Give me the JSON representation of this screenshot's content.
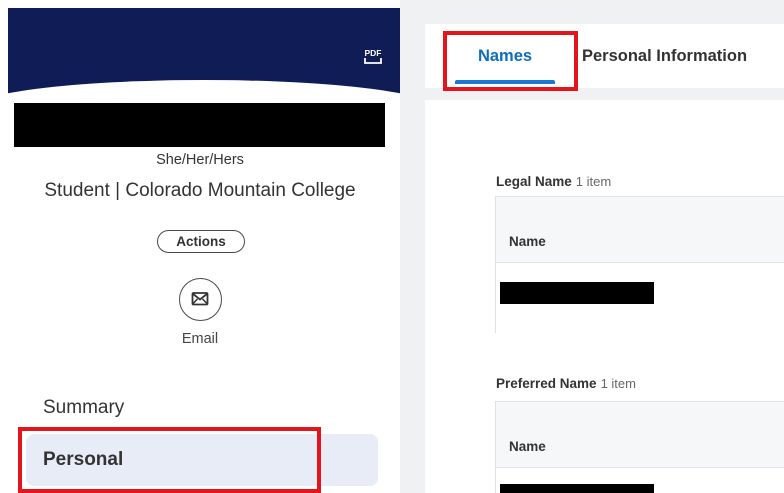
{
  "profile": {
    "pronouns": "She/Her/Hers",
    "job_title": "Student | Colorado Mountain College",
    "actions_label": "Actions",
    "email_label": "Email",
    "pdf_icon_label": "PDF"
  },
  "nav": {
    "items": [
      {
        "label": "Summary",
        "selected": false
      },
      {
        "label": "Personal",
        "selected": true
      }
    ]
  },
  "tabs": [
    {
      "label": "Names",
      "selected": true
    },
    {
      "label": "Personal Information",
      "selected": false
    }
  ],
  "sections": [
    {
      "title": "Legal Name",
      "count": "1 item",
      "column": "Name"
    },
    {
      "title": "Preferred Name",
      "count": "1 item",
      "column": "Name"
    }
  ],
  "colors": {
    "banner": "#0f1c55",
    "accent_blue": "#0b6fbb",
    "highlight_red": "#e3141b",
    "nav_selected_bg": "#e8ecf7"
  },
  "icons": [
    "pdf-icon",
    "mail-icon"
  ]
}
